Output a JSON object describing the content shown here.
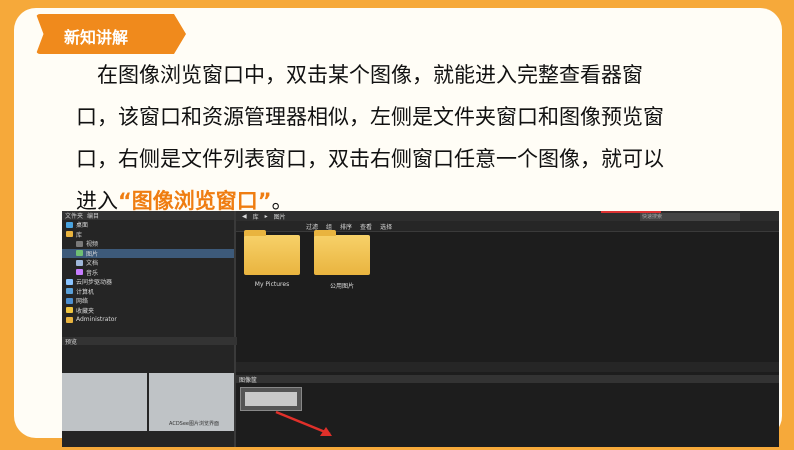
{
  "badge": {
    "label": "新知讲解"
  },
  "paragraph": {
    "line1": "在图像浏览窗口中，双击某个图像，就能进入完整查看器窗",
    "line2": "口，该窗口和资源管理器相似，左侧是文件夹窗口和图像预览窗",
    "line3": "口，右侧是文件列表窗口，双击右侧窗口任意一个图像，就可以",
    "line4_prefix": "进入",
    "line4_highlight": "“图像浏览窗口”",
    "line4_suffix": "。"
  },
  "screenshot": {
    "left_tabs": [
      "文件夹",
      "编目"
    ],
    "tree": [
      {
        "label": "桌面",
        "icon": "desktop-icon"
      },
      {
        "label": "库",
        "icon": "library-icon"
      },
      {
        "label": "视频",
        "icon": "video-icon"
      },
      {
        "label": "图片",
        "icon": "picture-icon",
        "selected": true
      },
      {
        "label": "文档",
        "icon": "document-icon"
      },
      {
        "label": "音乐",
        "icon": "music-icon"
      },
      {
        "label": "云同步驱动器",
        "icon": "cloud-icon"
      },
      {
        "label": "计算机",
        "icon": "computer-icon"
      },
      {
        "label": "网络",
        "icon": "network-icon"
      },
      {
        "label": "收藏夹",
        "icon": "favorites-icon"
      },
      {
        "label": "Administrator",
        "icon": "user-folder-icon"
      }
    ],
    "preview_label": "预览",
    "thumb_caption": "ACDSee图片浏览界面",
    "breadcrumb": [
      "库",
      "图片"
    ],
    "search_placeholder": "快速搜索",
    "toolbar": [
      "过滤",
      "组",
      "排序",
      "查看",
      "选择"
    ],
    "folders": [
      {
        "label": "My Pictures"
      },
      {
        "label": "公用图片"
      }
    ],
    "filmstrip_label": "图像筐",
    "colors": {
      "accent": "#ef7d11",
      "border": "#f6a93a",
      "arrow": "#e0302a"
    }
  }
}
